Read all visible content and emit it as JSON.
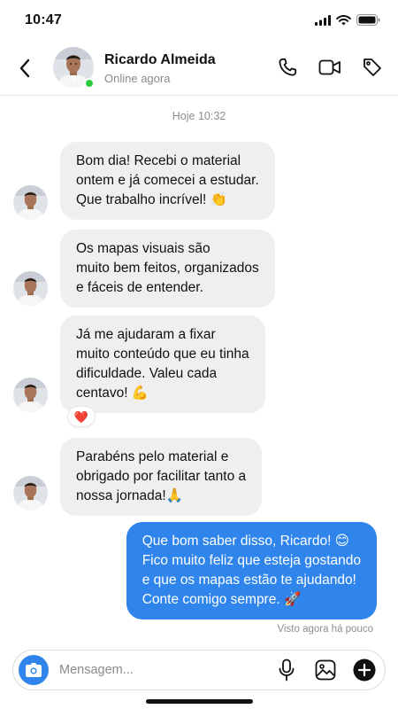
{
  "status_bar": {
    "time": "10:47"
  },
  "header": {
    "contact_name": "Ricardo Almeida",
    "contact_status": "Online agora"
  },
  "chat": {
    "date_separator": "Hoje 10:32",
    "messages": [
      {
        "direction": "incoming",
        "text": "Bom dia! Recebi o material\nontem e já comecei a estudar.\nQue trabalho incrível! 👏"
      },
      {
        "direction": "incoming",
        "text": "Os mapas visuais são\nmuito bem feitos, organizados\ne fáceis de entender."
      },
      {
        "direction": "incoming",
        "text": "Já me ajudaram a fixar\nmuito conteúdo que eu tinha\ndificuldade. Valeu cada\ncentavo! 💪",
        "reaction": "❤️"
      },
      {
        "direction": "incoming",
        "text": "Parabéns pelo material e\nobrigado por facilitar tanto a\nnossa jornada!🙏"
      },
      {
        "direction": "outgoing",
        "text": "Que bom saber disso, Ricardo! 😊\nFico muito feliz que esteja gostando\ne que os mapas estão te ajudando!\nConte comigo sempre. 🚀"
      }
    ],
    "seen_receipt": "Visto agora há pouco"
  },
  "composer": {
    "placeholder": "Mensagem..."
  },
  "colors": {
    "accent": "#2f85ec",
    "incoming_bubble": "#efefef",
    "online": "#2ecc40"
  },
  "icons": [
    "back-arrow-icon",
    "phone-icon",
    "video-icon",
    "tag-icon",
    "camera-icon",
    "microphone-icon",
    "image-icon",
    "plus-icon"
  ]
}
